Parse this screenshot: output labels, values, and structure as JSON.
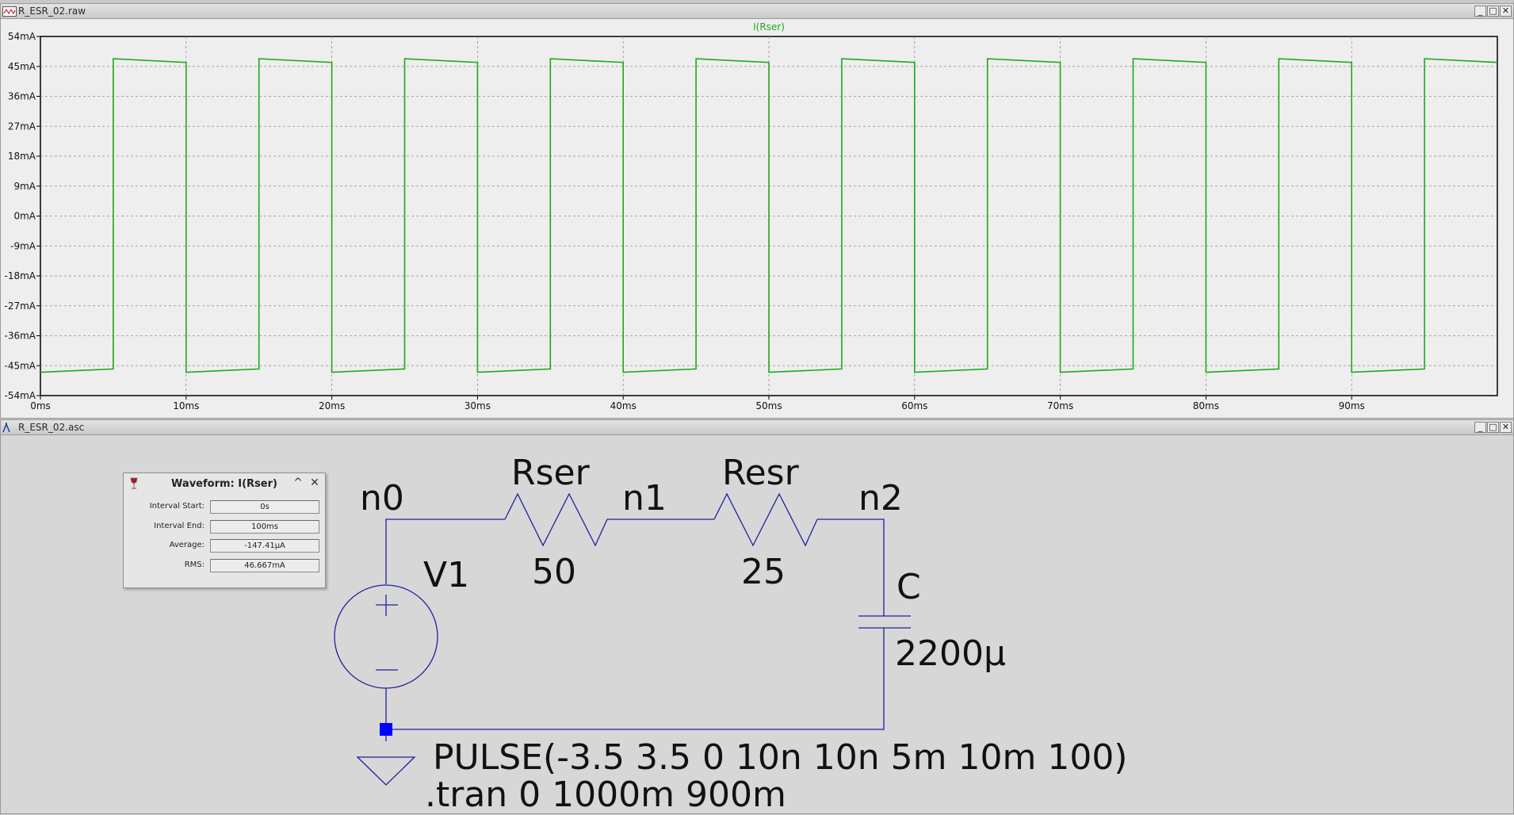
{
  "plot_window": {
    "title": "R_ESR_02.raw"
  },
  "schematic_window": {
    "title": "R_ESR_02.asc"
  },
  "window_buttons": {
    "minimize": "_",
    "restore": "□",
    "close": "✕"
  },
  "colors": {
    "trace": "#1aaa1a",
    "wire": "#2020a0",
    "plot_bg": "#eeeeee",
    "grid": "#909090",
    "schematic_bg": "#d7d7d7"
  },
  "chart_data": {
    "type": "line",
    "title": "I(Rser)",
    "xlabel": "",
    "ylabel": "",
    "xlim": [
      0,
      100
    ],
    "ylim": [
      -54,
      54
    ],
    "x_unit": "ms",
    "y_unit": "mA",
    "x_ticks": [
      "0ms",
      "10ms",
      "20ms",
      "30ms",
      "40ms",
      "50ms",
      "60ms",
      "70ms",
      "80ms",
      "90ms"
    ],
    "y_ticks": [
      "54mA",
      "45mA",
      "36mA",
      "27mA",
      "18mA",
      "9mA",
      "0mA",
      "-9mA",
      "-18mA",
      "-27mA",
      "-36mA",
      "-45mA",
      "-54mA"
    ],
    "grid": true,
    "series": [
      {
        "name": "I(Rser)",
        "points": [
          [
            0,
            -47.0
          ],
          [
            5,
            -46.0
          ],
          [
            5,
            47.3
          ],
          [
            10,
            46.2
          ],
          [
            10,
            -47.0
          ],
          [
            15,
            -46.0
          ],
          [
            15,
            47.3
          ],
          [
            20,
            46.2
          ],
          [
            20,
            -47.0
          ],
          [
            25,
            -46.0
          ],
          [
            25,
            47.3
          ],
          [
            30,
            46.2
          ],
          [
            30,
            -47.0
          ],
          [
            35,
            -46.0
          ],
          [
            35,
            47.3
          ],
          [
            40,
            46.2
          ],
          [
            40,
            -47.0
          ],
          [
            45,
            -46.0
          ],
          [
            45,
            47.3
          ],
          [
            50,
            46.2
          ],
          [
            50,
            -47.0
          ],
          [
            55,
            -46.0
          ],
          [
            55,
            47.3
          ],
          [
            60,
            46.2
          ],
          [
            60,
            -47.0
          ],
          [
            65,
            -46.0
          ],
          [
            65,
            47.3
          ],
          [
            70,
            46.2
          ],
          [
            70,
            -47.0
          ],
          [
            75,
            -46.0
          ],
          [
            75,
            47.3
          ],
          [
            80,
            46.2
          ],
          [
            80,
            -47.0
          ],
          [
            85,
            -46.0
          ],
          [
            85,
            47.3
          ],
          [
            90,
            46.2
          ],
          [
            90,
            -47.0
          ],
          [
            95,
            -46.0
          ],
          [
            95,
            47.3
          ],
          [
            100,
            46.2
          ]
        ]
      }
    ]
  },
  "waveform_dialog": {
    "title": "Waveform: I(Rser)",
    "collapse": "^",
    "close": "✕",
    "rows": [
      {
        "label": "Interval Start:",
        "value": "0s"
      },
      {
        "label": "Interval End:",
        "value": "100ms"
      },
      {
        "label": "Average:",
        "value": "-147.41µA"
      },
      {
        "label": "RMS:",
        "value": "46.667mA"
      }
    ]
  },
  "schematic": {
    "nodes": {
      "n0": "n0",
      "n1": "n1",
      "n2": "n2"
    },
    "rser": {
      "name": "Rser",
      "value": "50"
    },
    "resr": {
      "name": "Resr",
      "value": "25"
    },
    "cap": {
      "name": "C",
      "value": "2200µ"
    },
    "source": {
      "name": "V1",
      "value": "PULSE(-3.5 3.5 0 10n 10n 5m 10m 100)"
    },
    "directive": ".tran 0 1000m 900m"
  }
}
